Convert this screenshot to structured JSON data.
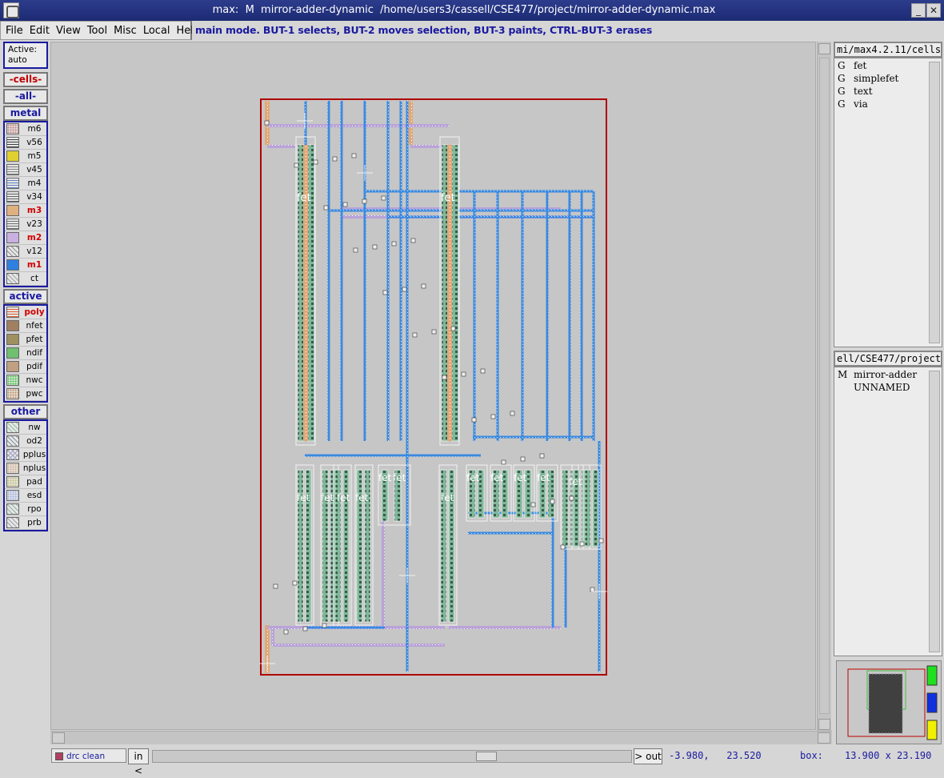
{
  "window": {
    "title": "max:  M  mirror-adder-dynamic  /home/users3/cassell/CSE477/project/mirror-adder-dynamic.max",
    "minimize_glyph": "_",
    "close_glyph": "✕"
  },
  "menu": [
    "File",
    "Edit",
    "View",
    "Tool",
    "Misc",
    "Local",
    "Help"
  ],
  "status_message": "main mode.  BUT-1 selects, BUT-2 moves selection, BUT-3 paints, CTRL-BUT-3 erases",
  "left_panel": {
    "active_label": "Active:",
    "active_value": "auto",
    "cells_label": "-cells-",
    "all_label": "-all-",
    "metal_label": "metal",
    "active_section_label": "active",
    "other_label": "other",
    "metal_layers": [
      {
        "name": "m6",
        "color": "#c08080",
        "pattern": "dots",
        "highlight": false
      },
      {
        "name": "v56",
        "color": "#404040",
        "pattern": "grid",
        "highlight": false
      },
      {
        "name": "m5",
        "color": "#e0d030",
        "pattern": "solid",
        "highlight": false
      },
      {
        "name": "v45",
        "color": "#808080",
        "pattern": "grid",
        "highlight": false
      },
      {
        "name": "m4",
        "color": "#6080c0",
        "pattern": "grid",
        "highlight": false
      },
      {
        "name": "v34",
        "color": "#606060",
        "pattern": "grid",
        "highlight": false
      },
      {
        "name": "m3",
        "color": "#e0b080",
        "pattern": "solid",
        "highlight": true
      },
      {
        "name": "v23",
        "color": "#707070",
        "pattern": "grid",
        "highlight": false
      },
      {
        "name": "m2",
        "color": "#c8b0e0",
        "pattern": "solid",
        "highlight": true
      },
      {
        "name": "v12",
        "color": "#909090",
        "pattern": "hatch",
        "highlight": false
      },
      {
        "name": "m1",
        "color": "#3080e0",
        "pattern": "solid",
        "highlight": true
      },
      {
        "name": "ct",
        "color": "#a0a0a0",
        "pattern": "hatch",
        "highlight": false
      }
    ],
    "active_layers": [
      {
        "name": "poly",
        "color": "#e06030",
        "pattern": "grid",
        "highlight": true
      },
      {
        "name": "nfet",
        "color": "#a08060",
        "pattern": "solid",
        "highlight": false
      },
      {
        "name": "pfet",
        "color": "#a09060",
        "pattern": "solid",
        "highlight": false
      },
      {
        "name": "ndif",
        "color": "#70c070",
        "pattern": "solid",
        "highlight": false
      },
      {
        "name": "pdif",
        "color": "#c0a080",
        "pattern": "solid",
        "highlight": false
      },
      {
        "name": "nwc",
        "color": "#40c040",
        "pattern": "dots",
        "highlight": false
      },
      {
        "name": "pwc",
        "color": "#c09060",
        "pattern": "dots",
        "highlight": false
      }
    ],
    "other_layers": [
      {
        "name": "nw",
        "color": "#90c0a0",
        "pattern": "hatch",
        "highlight": false
      },
      {
        "name": "od2",
        "color": "#8090a0",
        "pattern": "hatch",
        "highlight": false
      },
      {
        "name": "pplus",
        "color": "#a0a0c0",
        "pattern": "cross",
        "highlight": false
      },
      {
        "name": "nplus",
        "color": "#d0b090",
        "pattern": "dots",
        "highlight": false
      },
      {
        "name": "pad",
        "color": "#c0c080",
        "pattern": "dots",
        "highlight": false
      },
      {
        "name": "esd",
        "color": "#a0b0e0",
        "pattern": "dots",
        "highlight": false
      },
      {
        "name": "rpo",
        "color": "#90b0a0",
        "pattern": "hatch",
        "highlight": false
      },
      {
        "name": "prb",
        "color": "#a0a0b0",
        "pattern": "hatch",
        "highlight": false
      }
    ]
  },
  "right_panel": {
    "library_header": "mi/max4.2.11/cells",
    "library_cells": [
      {
        "tag": "G",
        "name": "fet"
      },
      {
        "tag": "G",
        "name": "simplefet"
      },
      {
        "tag": "G",
        "name": "text"
      },
      {
        "tag": "G",
        "name": "via"
      }
    ],
    "project_header": "ell/CSE477/project",
    "project_cells": [
      {
        "tag": "M",
        "name": "mirror-adder"
      },
      {
        "tag": "",
        "name": "UNNAMED"
      }
    ]
  },
  "minimap_colors": [
    "#20e020",
    "#1030e0",
    "#f0f000"
  ],
  "bottom_bar": {
    "drc_status": "drc clean",
    "zoom_in_label": "in <",
    "zoom_out_label": "> out",
    "cursor_coords": "-3.980,   23.520",
    "box_label": "box:",
    "box_size": "13.900 x 23.190"
  },
  "layout_labels": {
    "fet_label": "fet",
    "fets_top": [
      "fet",
      "fet"
    ],
    "fets_bottom": [
      "fet",
      "fet",
      "fet",
      "fet",
      "fet",
      "fet",
      "fet",
      "fet",
      "fet",
      "fet",
      "fet",
      "fet"
    ]
  }
}
